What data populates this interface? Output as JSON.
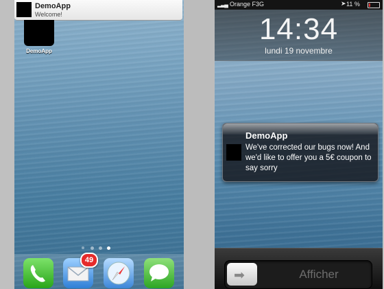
{
  "left_screen": {
    "banner": {
      "app_name": "DemoApp",
      "message": "Welcome!"
    },
    "home_app": {
      "label": "DemoApp"
    },
    "page_indicator": {
      "pages": 4,
      "current": 4
    },
    "dock": {
      "apps": [
        "phone-icon",
        "mail-icon",
        "safari-icon",
        "messages-icon"
      ],
      "mail_badge": "49"
    }
  },
  "right_screen": {
    "status_bar": {
      "carrier": "Orange F",
      "network": "3G",
      "battery": "11 %"
    },
    "lock": {
      "time": "14:34",
      "date": "lundi 19 novembre"
    },
    "notification": {
      "app_name": "DemoApp",
      "body": "We've corrected our bugs now! And we'd like to offer you a 5€ coupon to say sorry"
    },
    "unlock_slider": {
      "label": "Afficher"
    }
  },
  "colors": {
    "mail_badge": "#e52b2b",
    "battery_low": "#dd3333"
  }
}
